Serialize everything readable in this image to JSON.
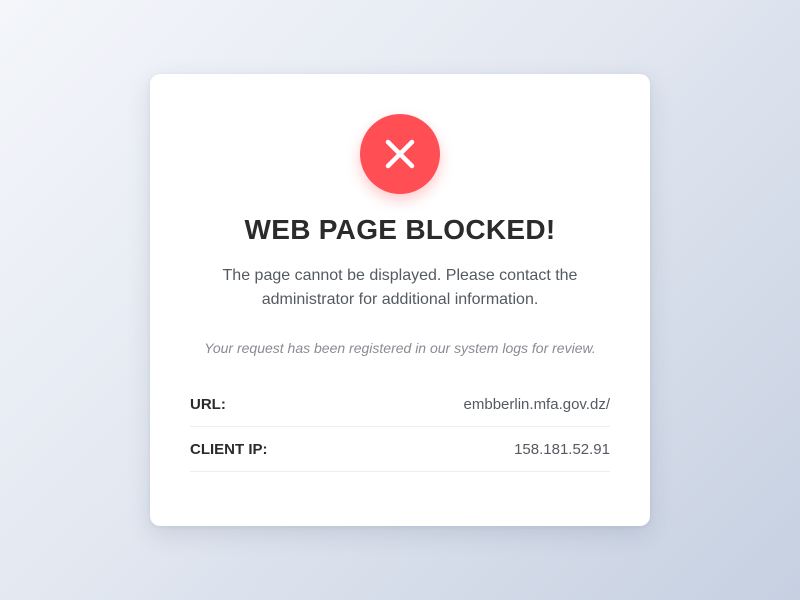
{
  "colors": {
    "accent": "#ff4f55",
    "title": "#2b2b2b",
    "text": "#555a60",
    "muted": "#888c92"
  },
  "icon": "close-x-icon",
  "title": "WEB PAGE BLOCKED!",
  "message": "The page cannot be displayed. Please contact the administrator for additional information.",
  "note": "Your request has been registered in our system logs for review.",
  "details": [
    {
      "label": "URL:",
      "value": "embberlin.mfa.gov.dz/"
    },
    {
      "label": "CLIENT IP:",
      "value": "158.181.52.91"
    }
  ]
}
